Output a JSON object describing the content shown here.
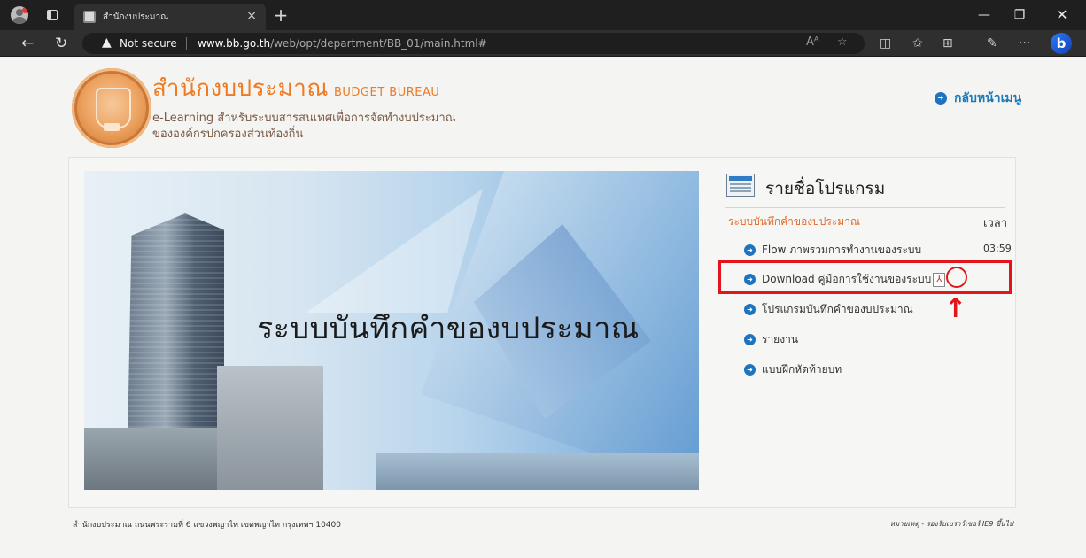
{
  "browser": {
    "tab_title": "สำนักงบประมาณ",
    "tab_close": "×",
    "new_tab": "+",
    "not_secure": "Not secure",
    "url_host": "www.bb.go.th",
    "url_path": "/web/opt/department/BB_01/main.html#",
    "more": "···"
  },
  "header": {
    "title_th": "สำนักงบประมาณ",
    "title_en": "BUDGET BUREAU",
    "subtitle_line1": "e-Learning สำหรับระบบสารสนเทศเพื่อการจัดทำงบประมาณ",
    "subtitle_line2": "ขององค์กรปกครองส่วนท้องถิ่น",
    "back_menu": "กลับหน้าเมนู"
  },
  "banner": {
    "text": "ระบบบันทึกคำของบประมาณ"
  },
  "program_list": {
    "title": "รายชื่อโปรแกรม",
    "subheading": "ระบบบันทึกคำของบประมาณ",
    "time_label": "เวลา",
    "items": [
      {
        "label": "Flow ภาพรวมการทำงานของระบบ",
        "time": "03:59"
      },
      {
        "label": "Download คู่มือการใช้งานของระบบ",
        "time": ""
      },
      {
        "label": "โปรแกรมบันทึกคำของบประมาณ",
        "time": ""
      },
      {
        "label": "รายงาน",
        "time": ""
      },
      {
        "label": "แบบฝึกหัดท้ายบท",
        "time": ""
      }
    ]
  },
  "footer": {
    "address": "สำนักงบประมาณ ถนนพระรามที่ 6 แขวงพญาไท เขตพญาไท กรุงเทพฯ 10400",
    "note": "หมายเหตุ - รองรับเบราว์เซอร์ IE9 ขึ้นไป"
  },
  "colors": {
    "accent_orange": "#ef7a21",
    "link_blue": "#1e73be",
    "highlight_red": "#e3141b"
  }
}
